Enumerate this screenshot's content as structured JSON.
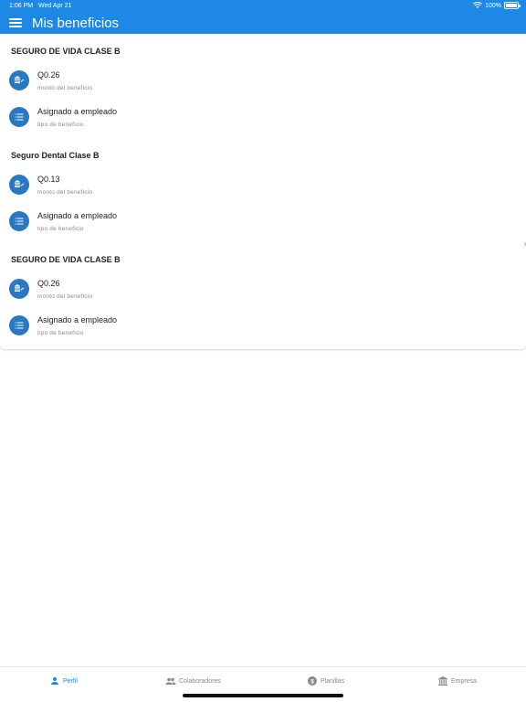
{
  "status": {
    "time": "1:06 PM",
    "date": "Wed Apr 21",
    "battery": "100%"
  },
  "header": {
    "title": "Mis beneficios"
  },
  "sections": [
    {
      "title": "SEGURO DE VIDA CLASE B",
      "amount": "Q0.26",
      "amount_caption": "monto del beneficio",
      "type": "Asignado a empleado",
      "type_caption": "tipo de beneficio"
    },
    {
      "title": "Seguro Dental Clase B",
      "amount": "Q0.13",
      "amount_caption": "monto del beneficio",
      "type": "Asignado a empleado",
      "type_caption": "tipo de beneficio"
    },
    {
      "title": "SEGURO DE VIDA CLASE B",
      "amount": "Q0.26",
      "amount_caption": "monto del beneficio",
      "type": "Asignado a empleado",
      "type_caption": "tipo de beneficio"
    }
  ],
  "nav": [
    {
      "label": "Perfil",
      "icon": "person-icon",
      "active": true
    },
    {
      "label": "Colaboradores",
      "icon": "people-icon",
      "active": false
    },
    {
      "label": "Planillas",
      "icon": "dollar-icon",
      "active": false
    },
    {
      "label": "Empresa",
      "icon": "bank-icon",
      "active": false
    }
  ],
  "colors": {
    "primary": "#1e88e5",
    "icon_circle": "#2a78c2",
    "inactive": "#8a8a8a"
  }
}
